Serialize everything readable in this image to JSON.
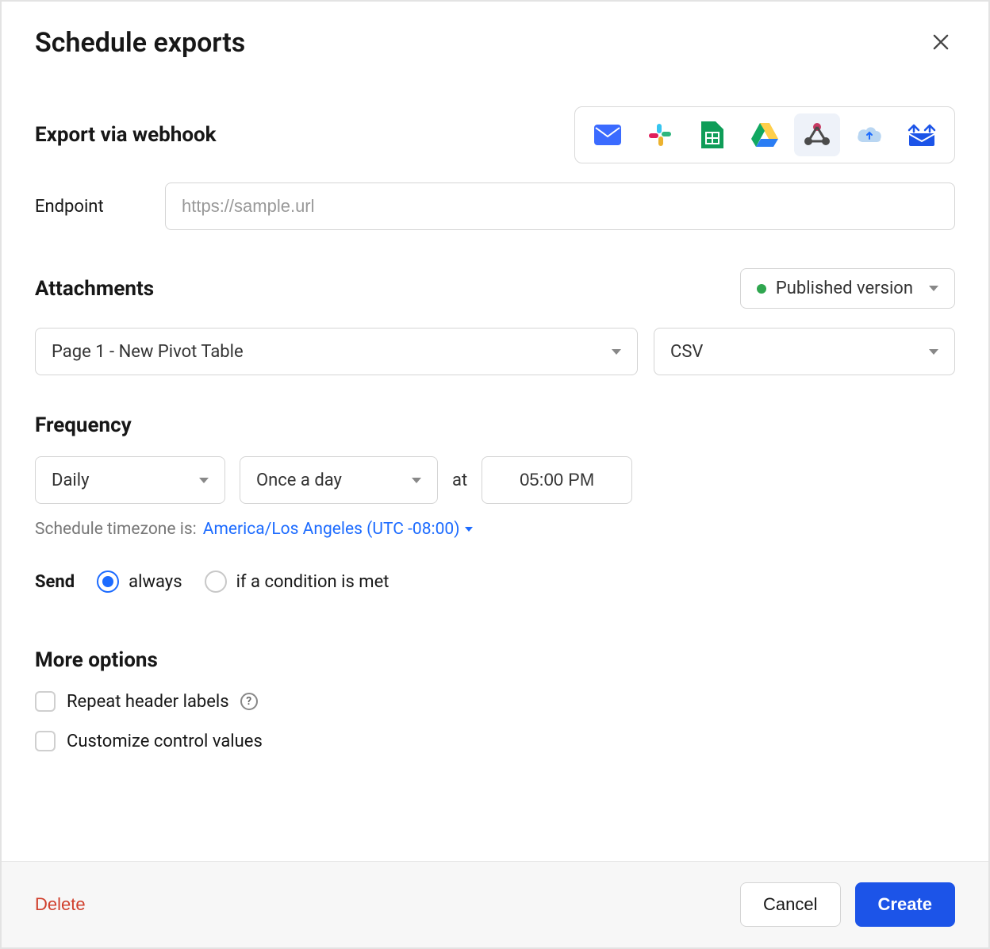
{
  "dialog": {
    "title": "Schedule exports"
  },
  "export": {
    "heading": "Export via webhook",
    "endpoint_label": "Endpoint",
    "endpoint_placeholder": "https://sample.url",
    "endpoint_value": ""
  },
  "attachments": {
    "heading": "Attachments",
    "version": "Published version",
    "page": "Page 1 - New Pivot Table",
    "format": "CSV"
  },
  "frequency": {
    "heading": "Frequency",
    "interval": "Daily",
    "repeat": "Once a day",
    "at_label": "at",
    "time": "05:00 PM",
    "tz_label": "Schedule timezone is:",
    "tz_value": "America/Los Angeles (UTC -08:00)"
  },
  "send": {
    "label": "Send",
    "option_always": "always",
    "option_condition": "if a condition is met",
    "selected": "always"
  },
  "more": {
    "heading": "More options",
    "repeat_headers": "Repeat header labels",
    "customize_controls": "Customize control values"
  },
  "footer": {
    "delete": "Delete",
    "cancel": "Cancel",
    "create": "Create"
  }
}
